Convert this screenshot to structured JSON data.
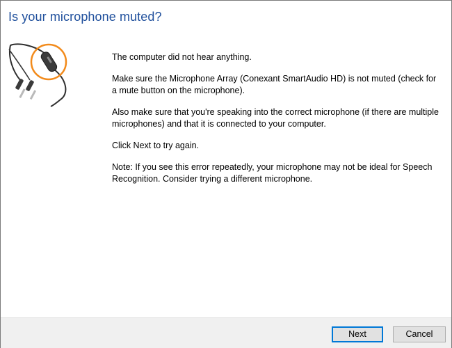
{
  "dialog": {
    "title": "Is your microphone muted?",
    "illustration_icon": "microphone-cable-icon",
    "accent_color": "#f28a1a",
    "title_color": "#1f4f9c",
    "paragraphs": [
      "The computer did not hear anything.",
      "Make sure the Microphone Array (Conexant SmartAudio HD) is not muted (check for a mute button on the microphone).",
      "Also make sure that you're speaking into the correct microphone (if there are multiple microphones) and that it is connected to your computer.",
      "Click Next to try again.",
      "Note: If you see this error repeatedly, your microphone may not be ideal for Speech Recognition. Consider trying a different microphone."
    ]
  },
  "footer": {
    "next_label": "Next",
    "cancel_label": "Cancel"
  }
}
